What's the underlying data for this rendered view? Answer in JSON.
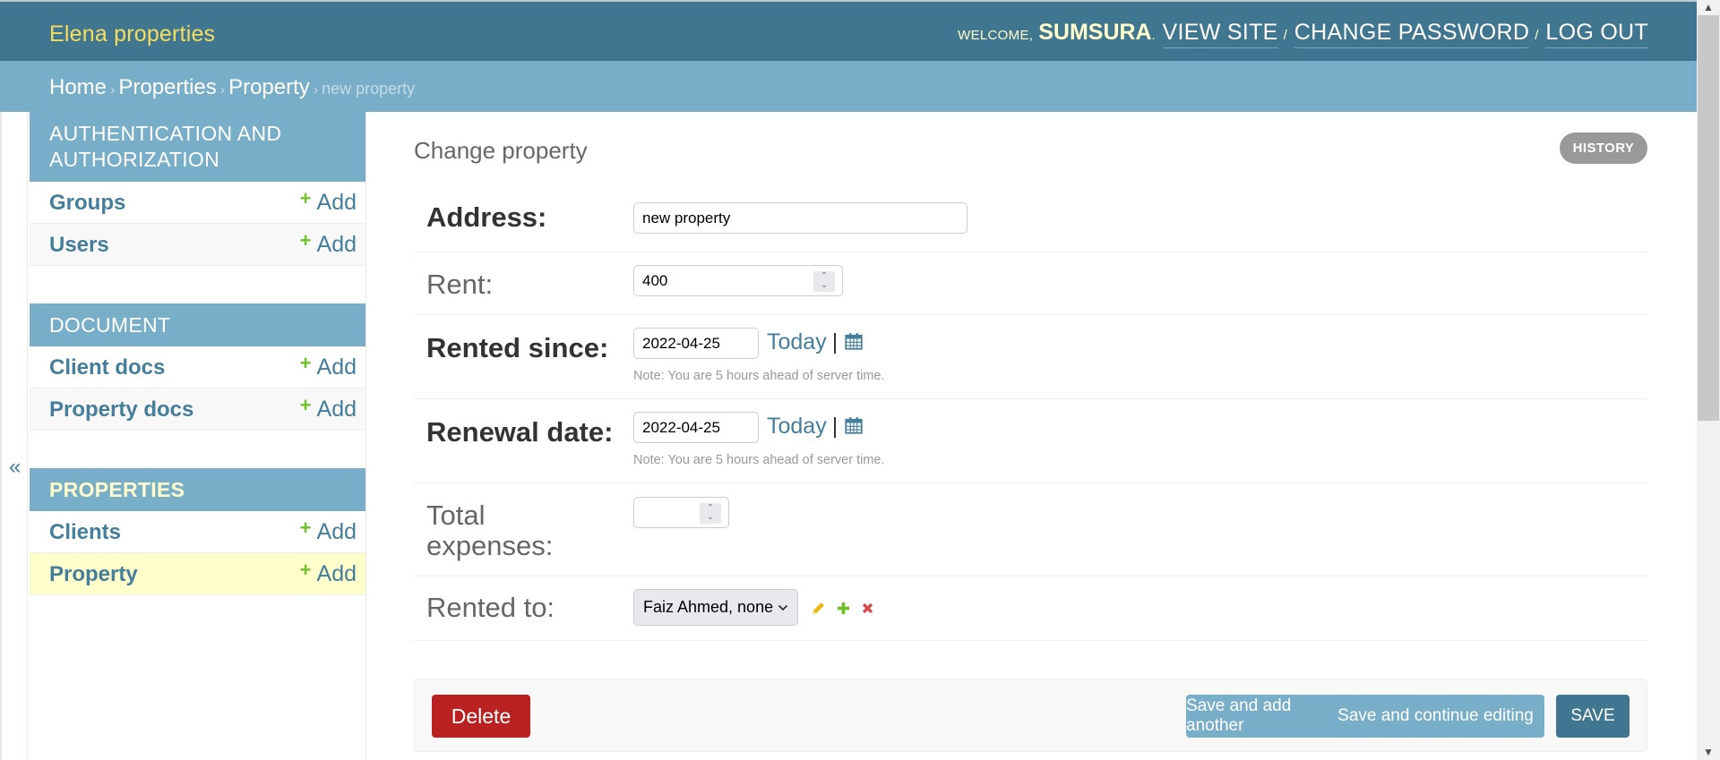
{
  "header": {
    "site_title": "Elena properties",
    "welcome": "WELCOME,",
    "username": "SUMSURA",
    "links": [
      {
        "label": "VIEW SITE"
      },
      {
        "label": "CHANGE PASSWORD"
      },
      {
        "label": "LOG OUT"
      }
    ],
    "separator": "/"
  },
  "breadcrumbs": {
    "items": [
      "Home",
      "Properties",
      "Property"
    ],
    "current": "new property",
    "arrow": "›"
  },
  "sidebar": {
    "toggle_glyph": "«",
    "add_label": "Add",
    "modules": [
      {
        "title": "AUTHENTICATION AND AUTHORIZATION",
        "models": [
          {
            "name": "Groups"
          },
          {
            "name": "Users"
          }
        ]
      },
      {
        "title": "DOCUMENT",
        "models": [
          {
            "name": "Client docs"
          },
          {
            "name": "Property docs"
          }
        ]
      },
      {
        "title": "PROPERTIES",
        "current": true,
        "models": [
          {
            "name": "Clients"
          },
          {
            "name": "Property",
            "current": true
          }
        ]
      }
    ]
  },
  "main": {
    "title": "Change property",
    "history_label": "HISTORY",
    "fields": {
      "address": {
        "label": "Address:",
        "value": "new property",
        "required": true
      },
      "rent": {
        "label": "Rent:",
        "value": "400"
      },
      "rented_since": {
        "label": "Rented since:",
        "value": "2022-04-25",
        "today_label": "Today",
        "help": "Note: You are 5 hours ahead of server time.",
        "required": true
      },
      "renewal_date": {
        "label": "Renewal date:",
        "value": "2022-04-25",
        "today_label": "Today",
        "help": "Note: You are 5 hours ahead of server time.",
        "required": true
      },
      "total_expenses": {
        "label_line1": "Total",
        "label_line2": "expenses:",
        "value": ""
      },
      "rented_to": {
        "label": "Rented to:",
        "selected": "Faiz Ahmed, none"
      }
    },
    "pipe": "|",
    "submit": {
      "delete": "Delete",
      "save_add_another": "Save and add another",
      "save_continue": "Save and continue editing",
      "save": "SAVE"
    }
  },
  "colors": {
    "header_bg": "#417690",
    "breadcrumb_bg": "#79aec8",
    "site_title": "#f5dd5d",
    "link": "#447e9b",
    "current_row": "#ffffcc",
    "delete": "#ba2121",
    "add_green": "#70bf2b"
  }
}
